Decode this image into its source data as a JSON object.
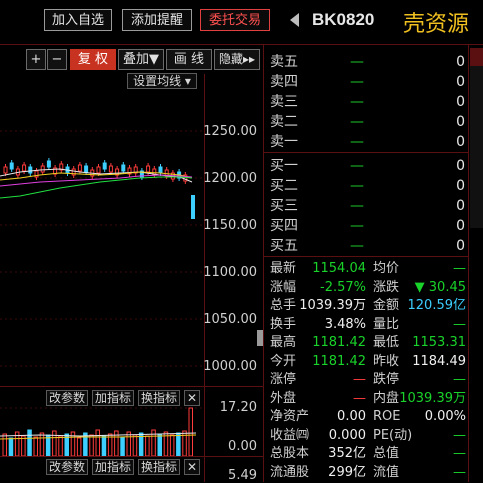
{
  "topbar": {
    "add_watchlist": "加入自选",
    "add_alert": "添加提醒",
    "delegate_trade": "委托交易",
    "code": "BK0820",
    "name": "壳资源"
  },
  "toolbar": {
    "plus": "+",
    "minus": "−",
    "rights": "复 权",
    "overlay": "叠加▼",
    "draw": "画 线",
    "hide": "隐藏▸▸",
    "ma_settings": "设置均线 ▾"
  },
  "price_axis": [
    "1250.00",
    "1200.00",
    "1150.00",
    "1100.00",
    "1050.00",
    "1000.00"
  ],
  "volume_axis": [
    "17.20",
    "0.00"
  ],
  "lower_axis": [
    "5.49"
  ],
  "indicator_buttons": {
    "params": "改参数",
    "add": "加指标",
    "change": "换指标",
    "close": "✕"
  },
  "orderbook": {
    "asks": [
      {
        "label": "卖五",
        "vol": "—",
        "val": "0"
      },
      {
        "label": "卖四",
        "vol": "—",
        "val": "0"
      },
      {
        "label": "卖三",
        "vol": "—",
        "val": "0"
      },
      {
        "label": "卖二",
        "vol": "—",
        "val": "0"
      },
      {
        "label": "卖一",
        "vol": "—",
        "val": "0"
      }
    ],
    "bids": [
      {
        "label": "买一",
        "vol": "—",
        "val": "0"
      },
      {
        "label": "买二",
        "vol": "—",
        "val": "0"
      },
      {
        "label": "买三",
        "vol": "—",
        "val": "0"
      },
      {
        "label": "买四",
        "vol": "—",
        "val": "0"
      },
      {
        "label": "买五",
        "vol": "—",
        "val": "0"
      }
    ]
  },
  "quote": [
    {
      "l1": "最新",
      "v1": "1154.04",
      "c1": "g",
      "l2": "均价",
      "v2": "—",
      "c2": "g"
    },
    {
      "l1": "涨幅",
      "v1": "-2.57%",
      "c1": "g",
      "l2": "涨跌",
      "v2": "▼ 30.45",
      "c2": "g"
    },
    {
      "l1": "总手",
      "v1": "1039.39万",
      "c1": "w",
      "l2": "金额",
      "v2": "120.59亿",
      "c2": "c"
    },
    {
      "l1": "换手",
      "v1": "3.48%",
      "c1": "w",
      "l2": "量比",
      "v2": "—",
      "c2": "g"
    },
    {
      "l1": "最高",
      "v1": "1181.42",
      "c1": "g",
      "l2": "最低",
      "v2": "1153.31",
      "c2": "g"
    },
    {
      "l1": "今开",
      "v1": "1181.42",
      "c1": "g",
      "l2": "昨收",
      "v2": "1184.49",
      "c2": "w"
    },
    {
      "l1": "涨停",
      "v1": "—",
      "c1": "r",
      "l2": "跌停",
      "v2": "—",
      "c2": "g"
    },
    {
      "l1": "外盘",
      "v1": "—",
      "c1": "r",
      "l2": "内盘",
      "v2": "1039.39万",
      "c2": "g"
    },
    {
      "l1": "净资产",
      "v1": "0.00",
      "c1": "w",
      "l2": "ROE",
      "v2": "0.00%",
      "c2": "w"
    },
    {
      "l1": "收益㈣",
      "v1": "0.000",
      "c1": "w",
      "l2": "PE(动)",
      "v2": "—",
      "c2": "g"
    },
    {
      "l1": "总股本",
      "v1": "352亿",
      "c1": "w",
      "l2": "总值",
      "v2": "—",
      "c2": "g"
    },
    {
      "l1": "流通股",
      "v1": "299亿",
      "c1": "w",
      "l2": "流值",
      "v2": "—",
      "c2": "g"
    }
  ],
  "colors": {
    "up": "#ff3b3b",
    "down": "#19d32a",
    "accent": "#3ccfff",
    "frame": "#5a1010"
  }
}
